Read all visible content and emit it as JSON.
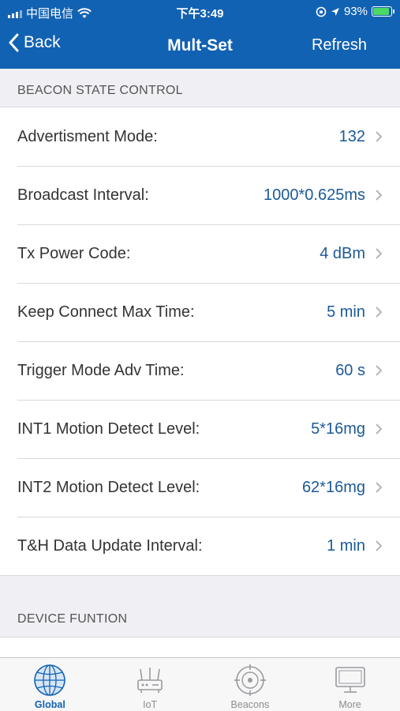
{
  "status_bar": {
    "carrier": "中国电信",
    "time": "下午3:49",
    "battery_percent": "93%",
    "battery_level": 0.93,
    "icons": [
      "signal-icon",
      "wifi-icon",
      "orientation-lock-icon",
      "location-icon",
      "battery-icon"
    ]
  },
  "nav": {
    "back_label": "Back",
    "title": "Mult-Set",
    "refresh_label": "Refresh"
  },
  "sections": {
    "state_control_header": "BEACON STATE CONTROL",
    "device_function_header": "DEVICE FUNTION"
  },
  "rows": [
    {
      "label": "Advertisment Mode:",
      "value": "132"
    },
    {
      "label": "Broadcast Interval:",
      "value": "1000*0.625ms"
    },
    {
      "label": "Tx Power Code:",
      "value": "4 dBm"
    },
    {
      "label": "Keep Connect Max Time:",
      "value": "5 min"
    },
    {
      "label": "Trigger Mode Adv Time:",
      "value": "60 s"
    },
    {
      "label": "INT1 Motion Detect Level:",
      "value": "5*16mg"
    },
    {
      "label": "INT2 Motion Detect Level:",
      "value": "62*16mg"
    },
    {
      "label": "T&H Data Update Interval:",
      "value": "1 min"
    }
  ],
  "tabs": [
    {
      "label": "Global",
      "icon": "globe-icon",
      "active": true
    },
    {
      "label": "IoT",
      "icon": "router-icon",
      "active": false
    },
    {
      "label": "Beacons",
      "icon": "target-icon",
      "active": false
    },
    {
      "label": "More",
      "icon": "monitor-icon",
      "active": false
    }
  ],
  "colors": {
    "brand_blue": "#1262b3",
    "value_blue": "#1b5a96",
    "battery_green": "#4cd964"
  }
}
